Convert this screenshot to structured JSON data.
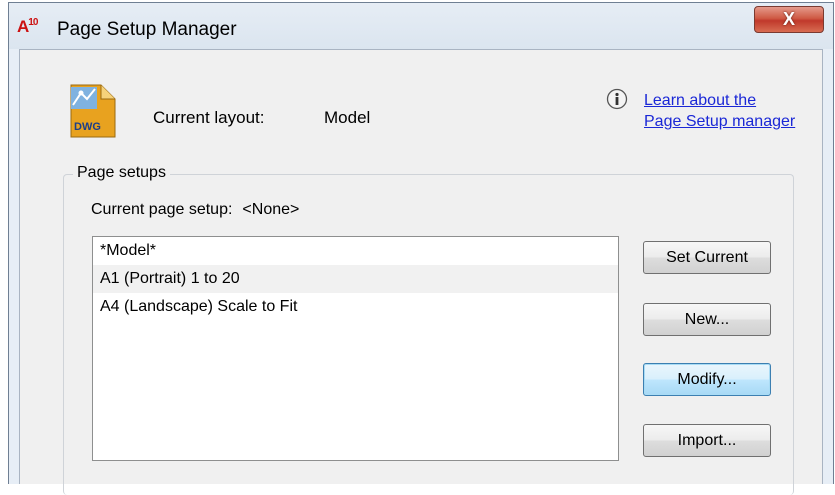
{
  "window": {
    "title": "Page Setup Manager",
    "app_logo_text": "A",
    "app_logo_suffix": "10",
    "close_label": "X"
  },
  "layout": {
    "label": "Current layout:",
    "value": "Model",
    "icon_text": "DWG"
  },
  "help": {
    "icon": "info-icon",
    "link_line1": "Learn about the",
    "link_line2": "Page Setup manager"
  },
  "page_setups": {
    "group_title": "Page setups",
    "current_label": "Current page setup:",
    "current_value": "<None>",
    "items": [
      {
        "label": "*Model*"
      },
      {
        "label": "A1 (Portrait) 1 to 20"
      },
      {
        "label": "A4 (Landscape) Scale to Fit"
      }
    ]
  },
  "buttons": {
    "set_current": "Set Current",
    "new": "New...",
    "modify": "Modify...",
    "import": "Import..."
  },
  "colors": {
    "link": "#1a27d6",
    "close_button": "#c0392b",
    "logo": "#cc1111",
    "dwg_icon": "#e8a21f"
  }
}
